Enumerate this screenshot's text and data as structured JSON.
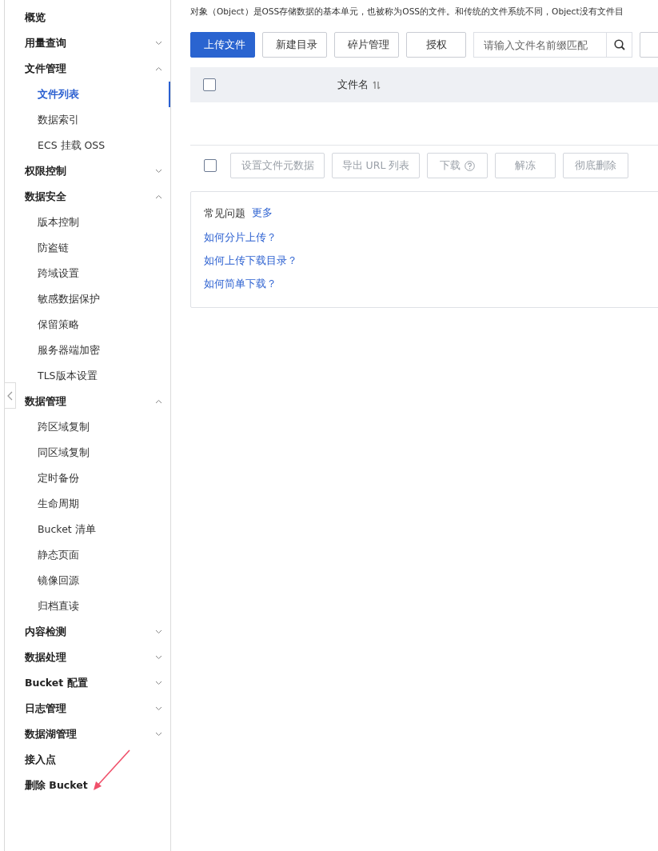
{
  "sidebar": {
    "items": [
      {
        "label": "概览",
        "selected": false
      },
      {
        "label": "用量查询",
        "selected": false,
        "expanded": false
      },
      {
        "label": "文件管理",
        "selected": false,
        "expanded": true,
        "children": [
          {
            "label": "文件列表",
            "selected": true
          },
          {
            "label": "数据索引",
            "selected": false
          },
          {
            "label": "ECS 挂载 OSS",
            "selected": false
          }
        ]
      },
      {
        "label": "权限控制",
        "selected": false,
        "expanded": false
      },
      {
        "label": "数据安全",
        "selected": false,
        "expanded": true,
        "children": [
          {
            "label": "版本控制",
            "selected": false
          },
          {
            "label": "防盗链",
            "selected": false
          },
          {
            "label": "跨域设置",
            "selected": false
          },
          {
            "label": "敏感数据保护",
            "selected": false
          },
          {
            "label": "保留策略",
            "selected": false
          },
          {
            "label": "服务器端加密",
            "selected": false
          },
          {
            "label": "TLS版本设置",
            "selected": false
          }
        ]
      },
      {
        "label": "数据管理",
        "selected": false,
        "expanded": true,
        "children": [
          {
            "label": "跨区域复制",
            "selected": false
          },
          {
            "label": "同区域复制",
            "selected": false
          },
          {
            "label": "定时备份",
            "selected": false
          },
          {
            "label": "生命周期",
            "selected": false
          },
          {
            "label": "Bucket 清单",
            "selected": false
          },
          {
            "label": "静态页面",
            "selected": false
          },
          {
            "label": "镜像回源",
            "selected": false
          },
          {
            "label": "归档直读",
            "selected": false
          }
        ]
      },
      {
        "label": "内容检测",
        "selected": false,
        "expanded": false
      },
      {
        "label": "数据处理",
        "selected": false,
        "expanded": false
      },
      {
        "label": "Bucket 配置",
        "selected": false,
        "expanded": false
      },
      {
        "label": "日志管理",
        "selected": false,
        "expanded": false
      },
      {
        "label": "数据湖管理",
        "selected": false,
        "expanded": false
      },
      {
        "label": "接入点",
        "selected": false
      },
      {
        "label": "删除 Bucket",
        "selected": false
      }
    ]
  },
  "description": "对象（Object）是OSS存储数据的基本单元，也被称为OSS的文件。和传统的文件系统不同，Object没有文件目",
  "toolbar": {
    "buttons": [
      {
        "label": "上传文件",
        "primary": true
      },
      {
        "label": "新建目录",
        "primary": false
      },
      {
        "label": "碎片管理",
        "primary": false
      },
      {
        "label": "授权",
        "primary": false
      }
    ],
    "search": {
      "placeholder": "请输入文件名前缀匹配"
    }
  },
  "table": {
    "select_all": {
      "checked": false
    },
    "columns": [
      "文件名"
    ]
  },
  "bulk_actions": {
    "select_all": {
      "checked": false
    },
    "buttons": [
      {
        "label": "设置文件元数据",
        "disabled": true
      },
      {
        "label": "导出 URL 列表",
        "disabled": true
      },
      {
        "label": "下载",
        "disabled": true,
        "help": true
      },
      {
        "label": "解冻",
        "disabled": true
      },
      {
        "label": "彻底删除",
        "disabled": true
      }
    ]
  },
  "faq": {
    "title": "常见问题",
    "more": "更多",
    "links": [
      "如何分片上传？",
      "如何上传下载目录？",
      "如何简单下载？"
    ]
  }
}
